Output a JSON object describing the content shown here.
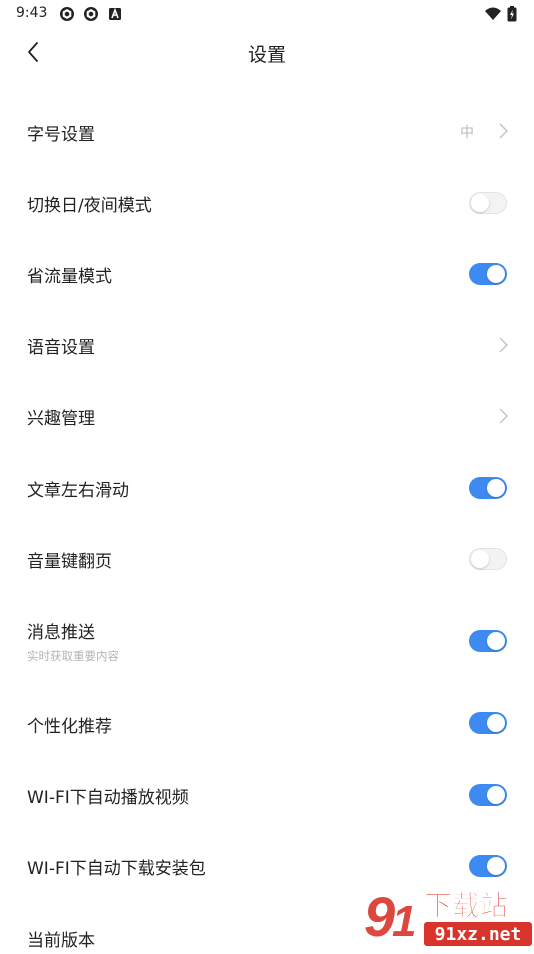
{
  "status_bar": {
    "time": "9:43",
    "left_icons": [
      "aperture-icon",
      "aperture-icon",
      "a-icon"
    ],
    "right_icons": [
      "wifi-icon",
      "battery-charging-icon"
    ]
  },
  "nav": {
    "title": "设置",
    "back_icon": "chevron-left-icon"
  },
  "colors": {
    "accent": "#3d8bf0",
    "toggle_off": "#f3f3f3",
    "muted_text": "#b4b4b4",
    "watermark_red": "#d9342b"
  },
  "settings": [
    {
      "id": "font-size",
      "label": "字号设置",
      "type": "nav",
      "value": "中"
    },
    {
      "id": "day-night",
      "label": "切换日/夜间模式",
      "type": "toggle",
      "on": false
    },
    {
      "id": "data-saver",
      "label": "省流量模式",
      "type": "toggle",
      "on": true
    },
    {
      "id": "voice",
      "label": "语音设置",
      "type": "nav"
    },
    {
      "id": "interests",
      "label": "兴趣管理",
      "type": "nav"
    },
    {
      "id": "swipe",
      "label": "文章左右滑动",
      "type": "toggle",
      "on": true
    },
    {
      "id": "volume-page",
      "label": "音量键翻页",
      "type": "toggle",
      "on": false
    },
    {
      "id": "push",
      "label": "消息推送",
      "sub": "实时获取重要内容",
      "type": "toggle",
      "on": true
    },
    {
      "id": "personalized",
      "label": "个性化推荐",
      "type": "toggle",
      "on": true
    },
    {
      "id": "wifi-video",
      "label": "WI-FI下自动播放视频",
      "type": "toggle",
      "on": true
    },
    {
      "id": "wifi-download",
      "label": "WI-FI下自动下载安装包",
      "type": "toggle",
      "on": true
    },
    {
      "id": "version",
      "label": "当前版本",
      "type": "info"
    }
  ],
  "watermark": {
    "brand": "下载站",
    "site": "91xz.net"
  }
}
